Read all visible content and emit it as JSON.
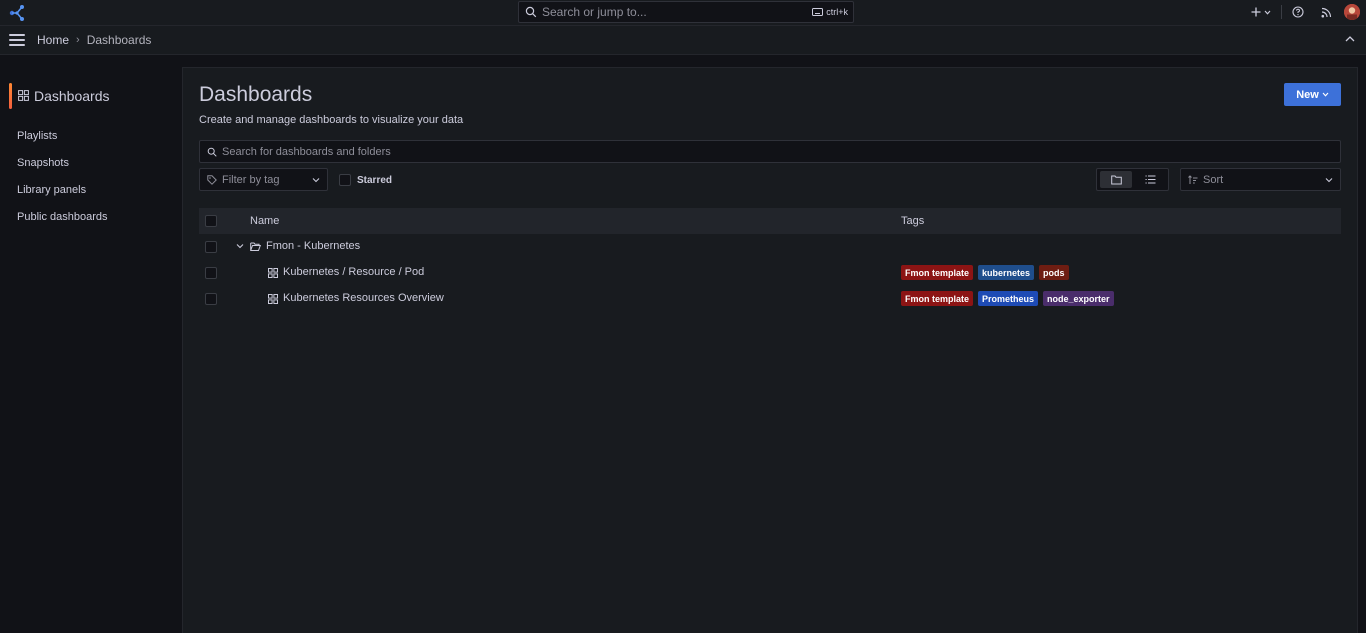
{
  "topbar": {
    "search_placeholder": "Search or jump to...",
    "shortcut": "ctrl+k",
    "icons": [
      "grafana-logo-icon",
      "search-icon",
      "keyboard-icon",
      "plus-icon",
      "help-icon",
      "rss-icon",
      "user-avatar"
    ]
  },
  "breadcrumb": {
    "home": "Home",
    "separator": "›",
    "current": "Dashboards"
  },
  "sidebar": {
    "active": "Dashboards",
    "items": [
      {
        "label": "Playlists"
      },
      {
        "label": "Snapshots"
      },
      {
        "label": "Library panels"
      },
      {
        "label": "Public dashboards"
      }
    ]
  },
  "page": {
    "title": "Dashboards",
    "subtitle": "Create and manage dashboards to visualize your data",
    "new_button": "New"
  },
  "filters": {
    "search_placeholder": "Search for dashboards and folders",
    "tag_filter_placeholder": "Filter by tag",
    "starred_label": "Starred",
    "sort_placeholder": "Sort"
  },
  "table": {
    "col_name": "Name",
    "col_tags": "Tags",
    "folder": {
      "name": "Fmon - Kubernetes",
      "expanded": true
    },
    "rows": [
      {
        "name": "Kubernetes / Resource / Pod",
        "tags": [
          {
            "label": "Fmon template",
            "color": "#8c1414"
          },
          {
            "label": "kubernetes",
            "color": "#1f4e8c"
          },
          {
            "label": "pods",
            "color": "#6e1d12"
          }
        ]
      },
      {
        "name": "Kubernetes Resources Overview",
        "tags": [
          {
            "label": "Fmon template",
            "color": "#8c1414"
          },
          {
            "label": "Prometheus",
            "color": "#1e4bb5"
          },
          {
            "label": "node_exporter",
            "color": "#4a2d6b"
          }
        ]
      }
    ]
  },
  "colors": {
    "accent": "#3d71d9",
    "active_bar": "#f55f3e",
    "background": "#111217",
    "panel": "#181b1f"
  }
}
